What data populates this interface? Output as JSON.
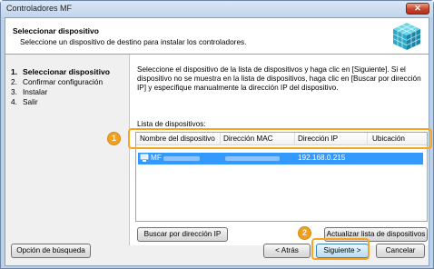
{
  "window": {
    "title": "Controladores MF",
    "close_glyph": "✕"
  },
  "header": {
    "title": "Seleccionar dispositivo",
    "subtitle": "Seleccione un dispositivo de destino para instalar los controladores.",
    "icon": "printer-cube-icon"
  },
  "steps": [
    {
      "num": "1.",
      "label": "Seleccionar dispositivo",
      "active": true
    },
    {
      "num": "2.",
      "label": "Confirmar configuración",
      "active": false
    },
    {
      "num": "3.",
      "label": "Instalar",
      "active": false
    },
    {
      "num": "4.",
      "label": "Salir",
      "active": false
    }
  ],
  "content": {
    "description": "Seleccione el dispositivo de la lista de dispositivos y haga clic en [Siguiente]. Si el dispositivo no se muestra en la lista de dispositivos, haga clic en [Buscar por dirección IP] y especifique manualmente la dirección IP del dispositivo.",
    "list_label": "Lista de dispositivos:",
    "columns": [
      "Nombre del dispositivo",
      "Dirección MAC",
      "Dirección IP",
      "Ubicación"
    ],
    "rows": [
      {
        "name": "MF",
        "mac": "",
        "ip": "192.168.0.215",
        "location": "",
        "selected": true
      }
    ],
    "search_ip_button": "Buscar por dirección IP",
    "refresh_button": "Actualizar lista de dispositivos"
  },
  "footer": {
    "search_options_button": "Opción de búsqueda",
    "back_button": "< Atrás",
    "next_button": "Siguiente >",
    "cancel_button": "Cancelar"
  },
  "callouts": [
    {
      "number": "1",
      "target": "device-row"
    },
    {
      "number": "2",
      "target": "next-button"
    }
  ],
  "colors": {
    "accent": "#3399ff",
    "callout": "#f0a020",
    "close": "#c9442b"
  }
}
